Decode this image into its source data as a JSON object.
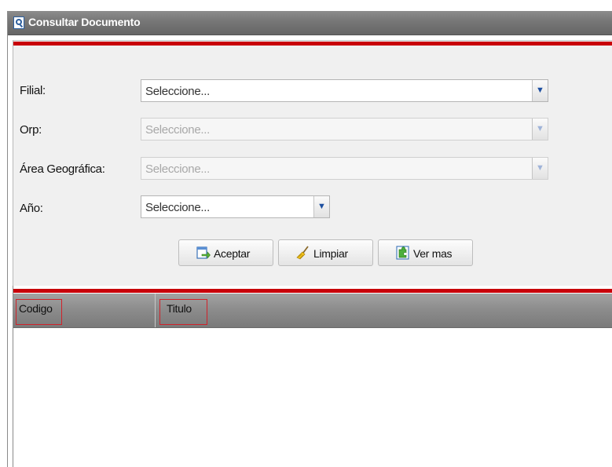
{
  "window": {
    "title": "Consultar Documento"
  },
  "form": {
    "fields": [
      {
        "label": "Filial:",
        "value": "Seleccione...",
        "enabled": true
      },
      {
        "label": "Orp:",
        "value": "Seleccione...",
        "enabled": false
      },
      {
        "label": "Área Geográfica:",
        "value": "Seleccione...",
        "enabled": false
      },
      {
        "label": "Año:",
        "value": "Seleccione...",
        "enabled": true
      }
    ],
    "buttons": [
      {
        "label": "Aceptar",
        "icon": "accept-arrow-icon"
      },
      {
        "label": "Limpiar",
        "icon": "broom-icon"
      },
      {
        "label": "Ver mas",
        "icon": "puzzle-icon"
      }
    ]
  },
  "grid": {
    "columns": [
      {
        "header": "Codigo"
      },
      {
        "header": "Titulo"
      }
    ],
    "rows": []
  },
  "colors": {
    "accent": "#c8000a",
    "highlight": "#d0222a",
    "header": "#8b8b8b"
  }
}
